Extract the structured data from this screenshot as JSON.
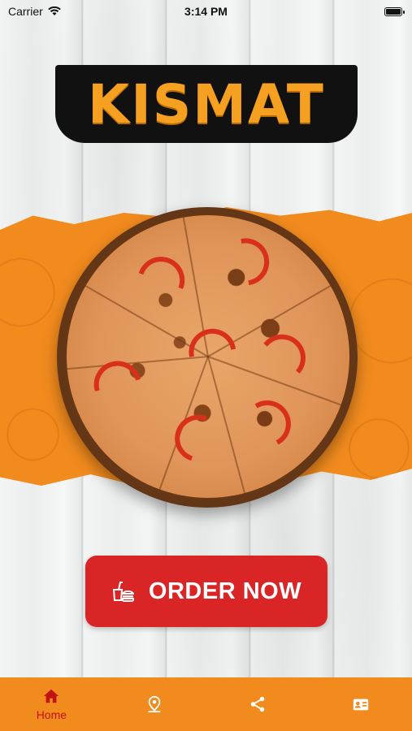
{
  "status_bar": {
    "carrier": "Carrier",
    "time": "3:14 PM"
  },
  "brand": {
    "logo_text": "KISMAT",
    "accent_color": "#f5a020"
  },
  "hero": {
    "image": "pizza-icon"
  },
  "order_button": {
    "label": "ORDER NOW",
    "icon": "fast-food-icon",
    "color": "#d92526"
  },
  "tab_bar": {
    "background": "#f28b1e",
    "active_color": "#c21313",
    "items": [
      {
        "label": "Home",
        "icon": "home-icon",
        "active": true
      },
      {
        "label": "",
        "icon": "location-pin-icon",
        "active": false
      },
      {
        "label": "",
        "icon": "share-icon",
        "active": false
      },
      {
        "label": "",
        "icon": "contact-card-icon",
        "active": false
      }
    ]
  }
}
